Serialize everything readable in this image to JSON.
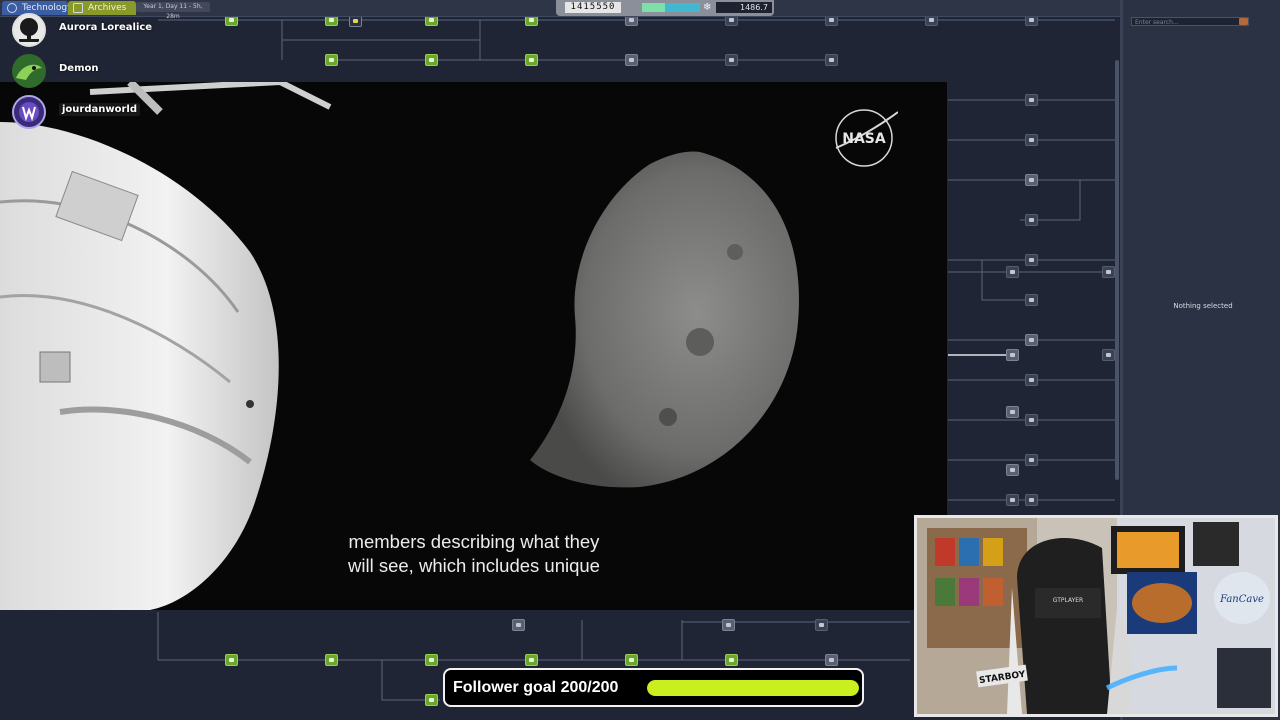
{
  "colors": {
    "tree_background": "#1f2535",
    "node_green": "#6aa82c",
    "goal_bar": "#c9ef1e",
    "side_panel": "#2b3243"
  },
  "game": {
    "tabs": [
      {
        "label": "Technology",
        "icon": "gear-icon"
      },
      {
        "label": "Archives",
        "icon": "folder-icon"
      }
    ],
    "date": "Year 1, Day 11 - 5h, 28m",
    "research_counter": "1415550",
    "power_level": 0.4,
    "energy_icon": "snowflake-icon",
    "energy_value": "1486.7",
    "search_placeholder": "Enter search...",
    "selection_status": "Nothing selected"
  },
  "viewers": [
    {
      "name": "Aurora Lorealice",
      "avatar": "tree-avatar"
    },
    {
      "name": "Demon",
      "avatar": "dragon-avatar"
    },
    {
      "name": "jourdanworld",
      "avatar": "jw-logo-avatar"
    }
  ],
  "video": {
    "logo_text": "NASA",
    "caption_lines": [
      "members describing what they",
      "will see, which includes unique"
    ]
  },
  "webcam": {
    "chair_brand": "GTPLAYER",
    "sign_text": "STARBOY"
  },
  "follower_goal": {
    "label": "Follower goal 200/200",
    "current": 200,
    "target": 200,
    "progress": 1.0
  }
}
